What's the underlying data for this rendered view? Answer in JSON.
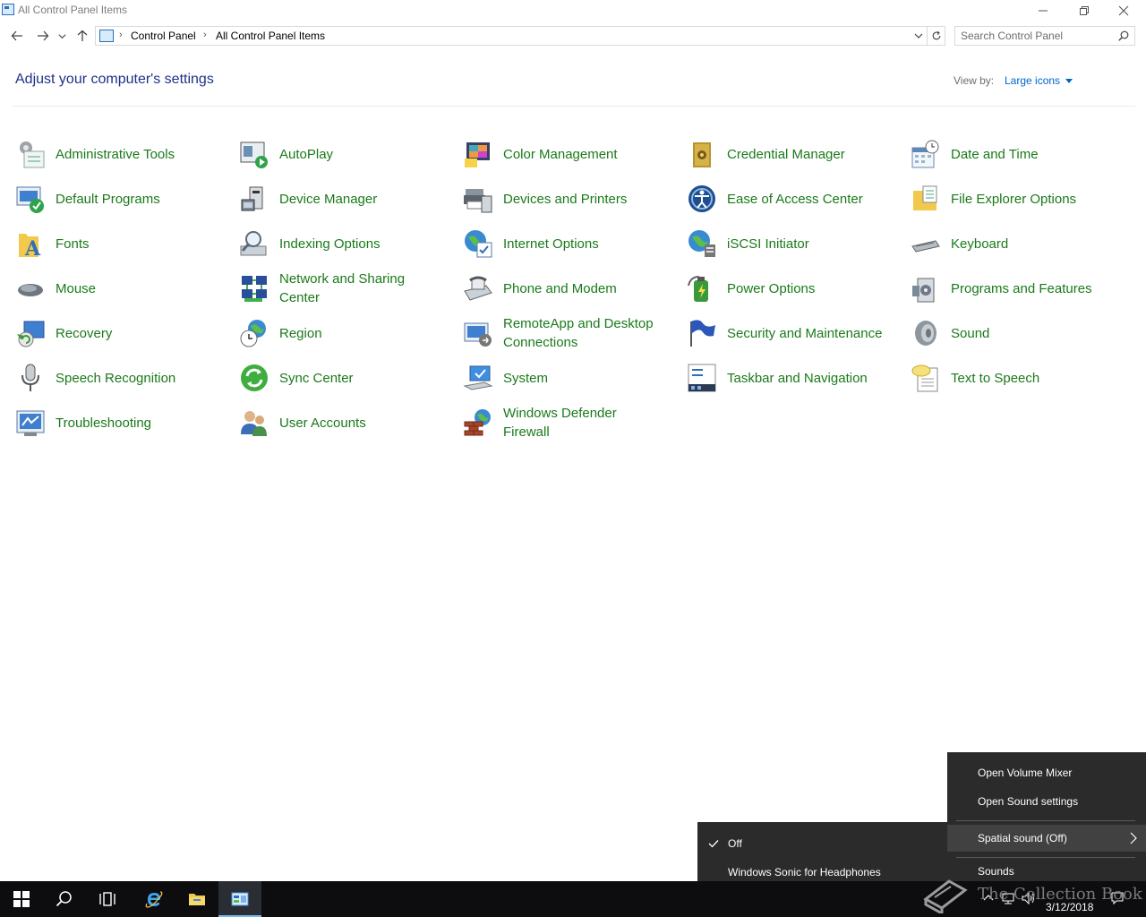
{
  "window": {
    "title": "All Control Panel Items"
  },
  "address": {
    "crumbs": [
      "Control Panel",
      "All Control Panel Items"
    ]
  },
  "search": {
    "placeholder": "Search Control Panel"
  },
  "header": {
    "title": "Adjust your computer's settings",
    "view_by_label": "View by:",
    "view_by_value": "Large icons"
  },
  "items": [
    {
      "label": "Administrative Tools",
      "icon": "administrative-tools-icon"
    },
    {
      "label": "AutoPlay",
      "icon": "autoplay-icon"
    },
    {
      "label": "Color Management",
      "icon": "color-management-icon"
    },
    {
      "label": "Credential Manager",
      "icon": "credential-manager-icon"
    },
    {
      "label": "Date and Time",
      "icon": "date-time-icon"
    },
    {
      "label": "Default Programs",
      "icon": "default-programs-icon"
    },
    {
      "label": "Device Manager",
      "icon": "device-manager-icon"
    },
    {
      "label": "Devices and Printers",
      "icon": "devices-printers-icon"
    },
    {
      "label": "Ease of Access Center",
      "icon": "ease-of-access-icon"
    },
    {
      "label": "File Explorer Options",
      "icon": "file-explorer-options-icon"
    },
    {
      "label": "Fonts",
      "icon": "fonts-icon"
    },
    {
      "label": "Indexing Options",
      "icon": "indexing-options-icon"
    },
    {
      "label": "Internet Options",
      "icon": "internet-options-icon"
    },
    {
      "label": "iSCSI Initiator",
      "icon": "iscsi-initiator-icon"
    },
    {
      "label": "Keyboard",
      "icon": "keyboard-icon"
    },
    {
      "label": "Mouse",
      "icon": "mouse-icon"
    },
    {
      "label": "Network and Sharing Center",
      "icon": "network-sharing-icon"
    },
    {
      "label": "Phone and Modem",
      "icon": "phone-modem-icon"
    },
    {
      "label": "Power Options",
      "icon": "power-options-icon"
    },
    {
      "label": "Programs and Features",
      "icon": "programs-features-icon"
    },
    {
      "label": "Recovery",
      "icon": "recovery-icon"
    },
    {
      "label": "Region",
      "icon": "region-icon"
    },
    {
      "label": "RemoteApp and Desktop Connections",
      "icon": "remoteapp-icon"
    },
    {
      "label": "Security and Maintenance",
      "icon": "security-maintenance-icon"
    },
    {
      "label": "Sound",
      "icon": "sound-icon"
    },
    {
      "label": "Speech Recognition",
      "icon": "speech-recognition-icon"
    },
    {
      "label": "Sync Center",
      "icon": "sync-center-icon"
    },
    {
      "label": "System",
      "icon": "system-icon"
    },
    {
      "label": "Taskbar and Navigation",
      "icon": "taskbar-navigation-icon"
    },
    {
      "label": "Text to Speech",
      "icon": "text-to-speech-icon"
    },
    {
      "label": "Troubleshooting",
      "icon": "troubleshooting-icon"
    },
    {
      "label": "User Accounts",
      "icon": "user-accounts-icon"
    },
    {
      "label": "Windows Defender Firewall",
      "icon": "firewall-icon"
    }
  ],
  "sound_menu": {
    "open_mixer": "Open Volume Mixer",
    "open_settings": "Open Sound settings",
    "spatial": "Spatial sound (Off)",
    "sounds": "Sounds"
  },
  "spatial_submenu": {
    "off": "Off",
    "sonic": "Windows Sonic for Headphones"
  },
  "taskbar": {
    "date": "3/12/2018",
    "watermark": "The Collection Book"
  }
}
